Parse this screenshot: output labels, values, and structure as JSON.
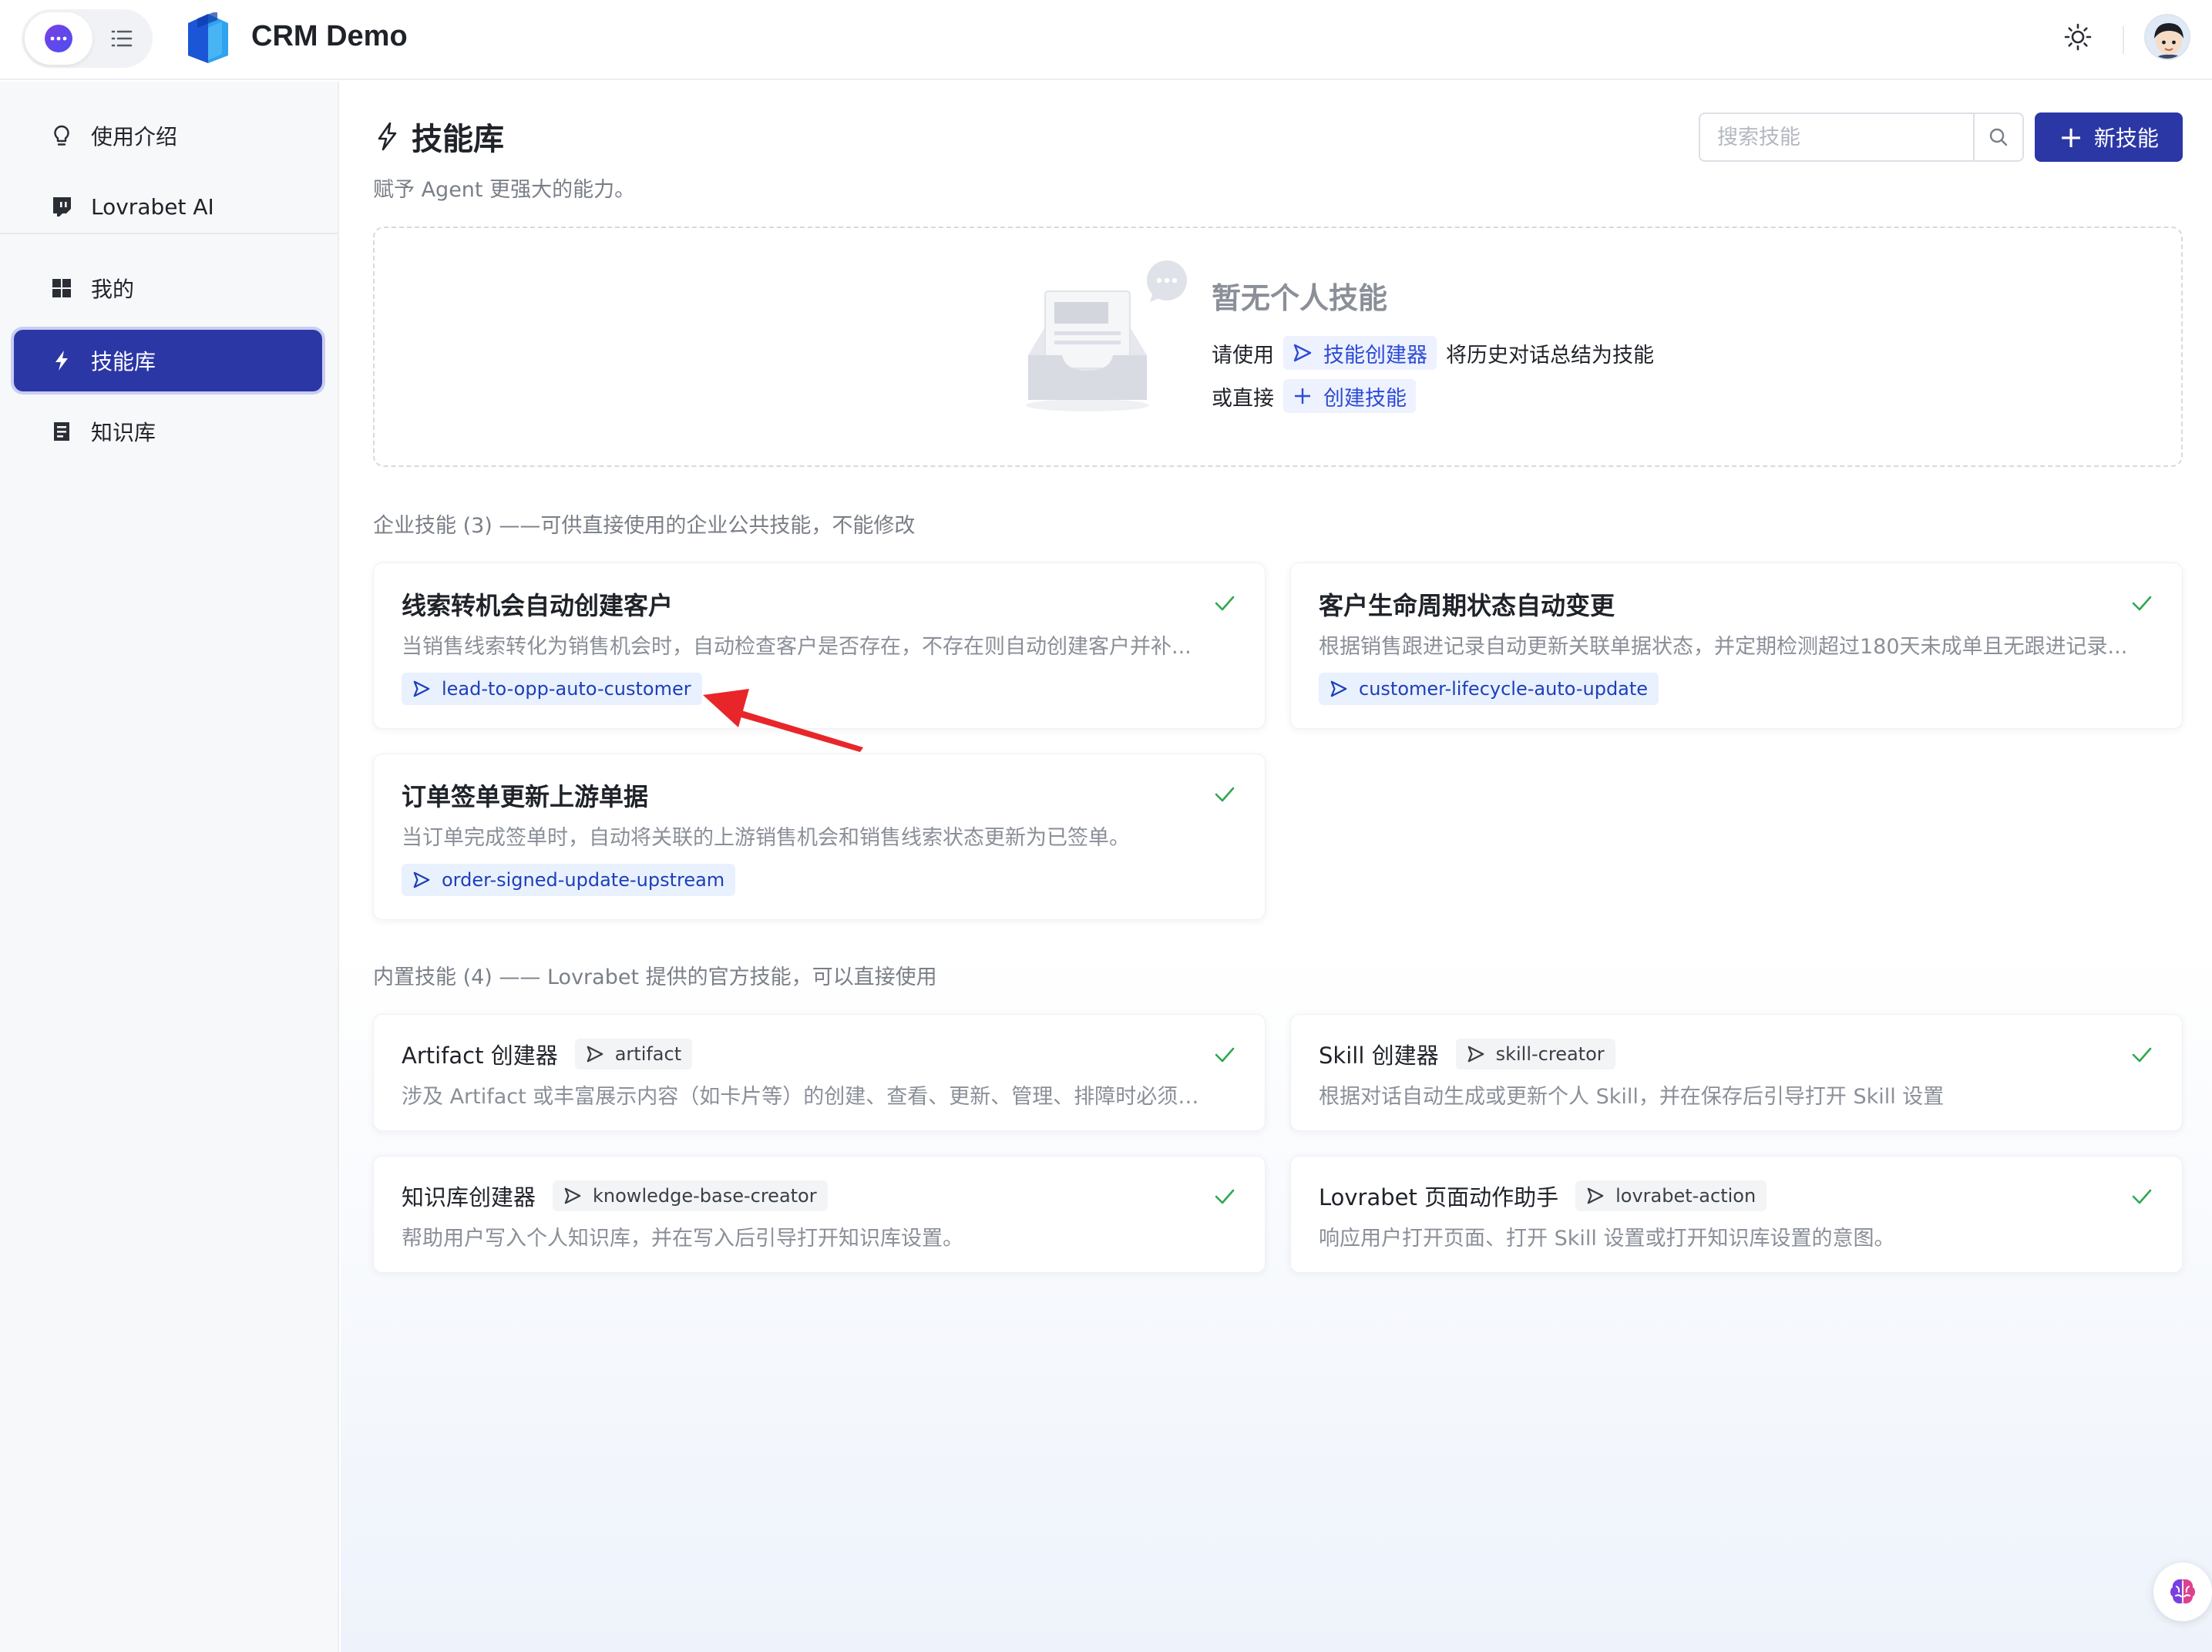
{
  "app": {
    "title": "CRM Demo"
  },
  "sidebar": {
    "items": [
      {
        "label": "使用介绍",
        "icon": "lightbulb-icon"
      },
      {
        "label": "Lovrabet AI",
        "icon": "twitch-icon"
      },
      {
        "label": "我的",
        "icon": "grid-icon"
      },
      {
        "label": "技能库",
        "icon": "lightning-icon",
        "active": true
      },
      {
        "label": "知识库",
        "icon": "book-icon"
      }
    ]
  },
  "header": {
    "title": "技能库",
    "subtitle": "赋予 Agent 更强大的能力。",
    "search_placeholder": "搜索技能",
    "new_button": "新技能"
  },
  "empty_state": {
    "title": "暂无个人技能",
    "line1_prefix": "请使用",
    "line1_link": "技能创建器",
    "line1_suffix": "将历史对话总结为技能",
    "line2_prefix": "或直接",
    "line2_link": "创建技能"
  },
  "enterprise": {
    "header": "企业技能 (3) ——可供直接使用的企业公共技能，不能修改",
    "cards": [
      {
        "title": "线索转机会自动创建客户",
        "desc": "当销售线索转化为销售机会时，自动检查客户是否存在，不存在则自动创建客户并补...",
        "tag": "lead-to-opp-auto-customer"
      },
      {
        "title": "客户生命周期状态自动变更",
        "desc": "根据销售跟进记录自动更新关联单据状态，并定期检测超过180天未成单且无跟进记录...",
        "tag": "customer-lifecycle-auto-update"
      },
      {
        "title": "订单签单更新上游单据",
        "desc": "当订单完成签单时，自动将关联的上游销售机会和销售线索状态更新为已签单。",
        "tag": "order-signed-update-upstream"
      }
    ]
  },
  "builtin": {
    "header": "内置技能 (4) —— Lovrabet 提供的官方技能，可以直接使用",
    "cards": [
      {
        "name": "Artifact 创建器",
        "tag": "artifact",
        "desc": "涉及 Artifact 或丰富展示内容（如卡片等）的创建、查看、更新、管理、排障时必须使..."
      },
      {
        "name": "Skill 创建器",
        "tag": "skill-creator",
        "desc": "根据对话自动生成或更新个人 Skill，并在保存后引导打开 Skill 设置"
      },
      {
        "name": "知识库创建器",
        "tag": "knowledge-base-creator",
        "desc": "帮助用户写入个人知识库，并在写入后引导打开知识库设置。"
      },
      {
        "name": "Lovrabet 页面动作助手",
        "tag": "lovrabet-action",
        "desc": "响应用户打开页面、打开 Skill 设置或打开知识库设置的意图。"
      }
    ]
  },
  "colors": {
    "accent": "#2c37a6",
    "link": "#2c4bd6",
    "check": "#2fa84f",
    "annotation_arrow": "#e8262a"
  }
}
